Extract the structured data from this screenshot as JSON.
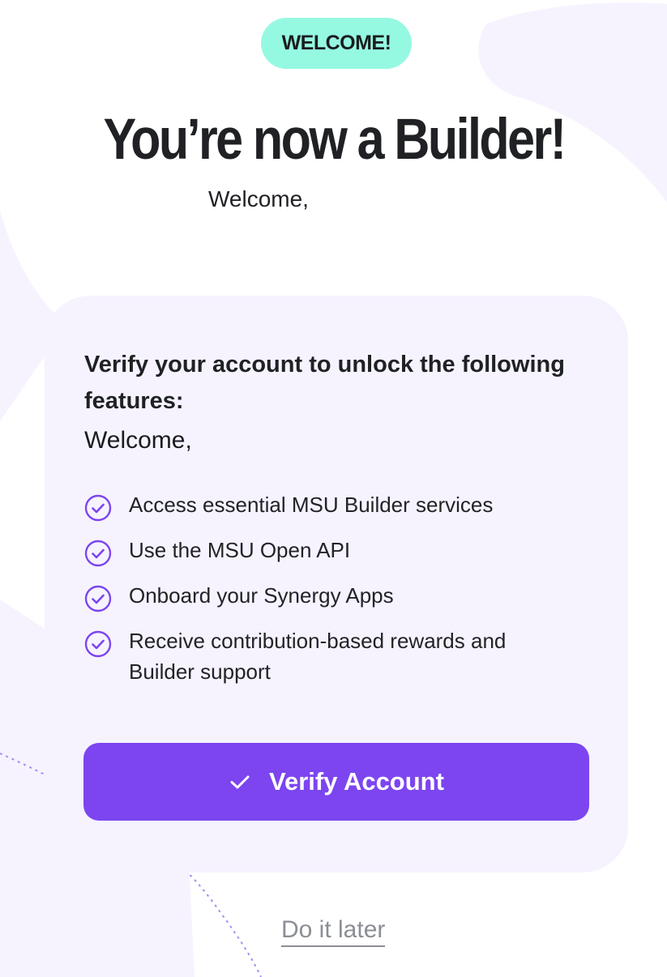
{
  "badge": {
    "label": "WELCOME!"
  },
  "header": {
    "title": "You’re now a Builder!",
    "subtitle": "Welcome,"
  },
  "card": {
    "heading": "Verify your account to unlock the following features:",
    "welcome": "Welcome,",
    "features": [
      {
        "label": "Access essential MSU Builder services",
        "icon": "check-circle-icon"
      },
      {
        "label": "Use the MSU Open API",
        "icon": "check-circle-icon"
      },
      {
        "label": "Onboard your Synergy Apps",
        "icon": "check-circle-icon"
      },
      {
        "label": "Receive contribution-based rewards and Builder support",
        "icon": "check-circle-icon"
      }
    ],
    "verify_button": {
      "label": "Verify Account",
      "icon": "check-icon"
    }
  },
  "later_link": {
    "label": "Do it later"
  },
  "colors": {
    "badge_bg": "#95f9e1",
    "card_bg": "#f6f3ff",
    "accent": "#7c45f0",
    "check_icon": "#7c45f0",
    "link": "#8b8e94",
    "text": "#1f2124"
  }
}
